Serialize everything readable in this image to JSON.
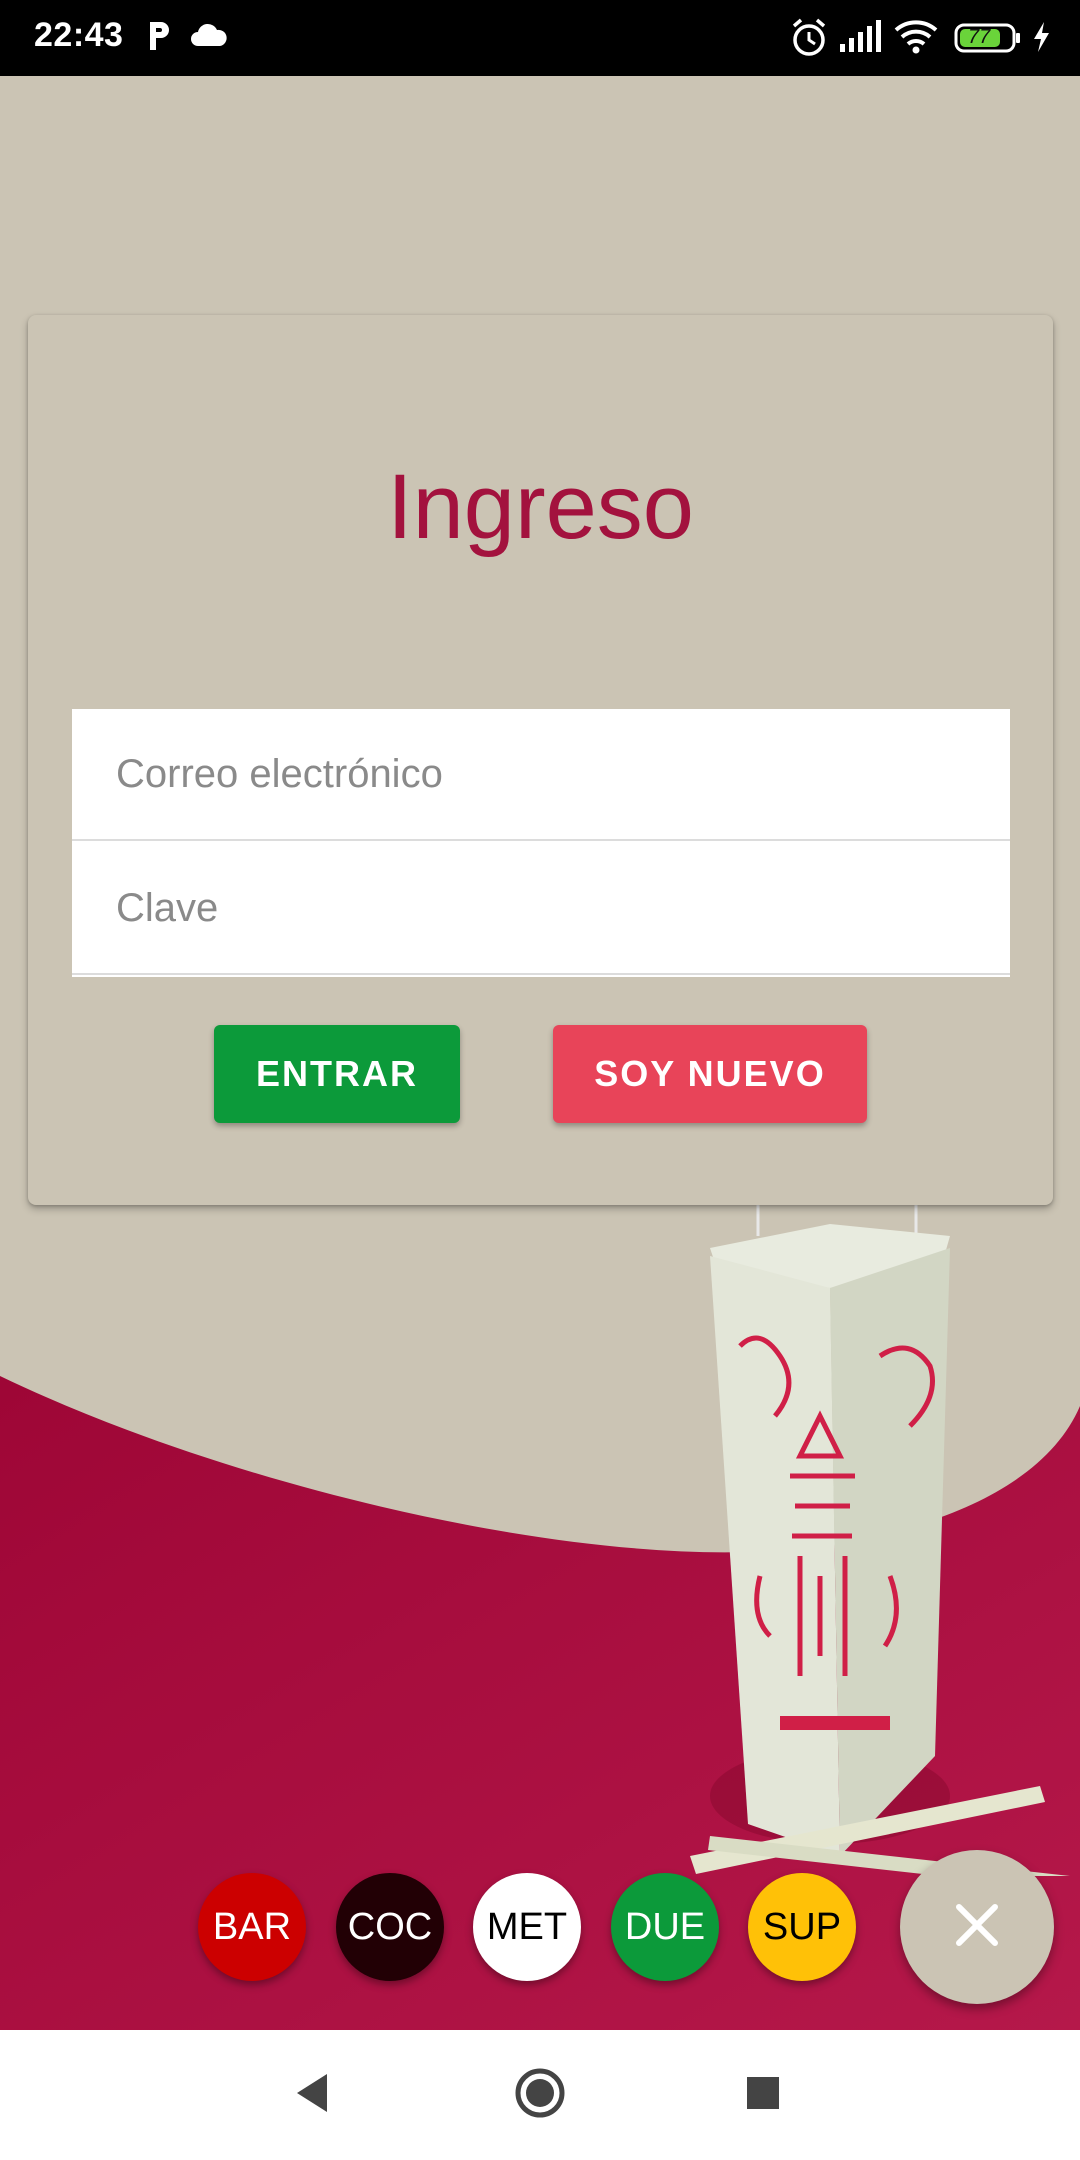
{
  "status_bar": {
    "time": "22:43",
    "battery": "77",
    "icons": [
      "parking-icon",
      "cloud-icon",
      "alarm-icon",
      "signal-icon",
      "wifi-icon",
      "battery-icon",
      "charging-icon"
    ]
  },
  "login": {
    "title": "Ingreso",
    "email_placeholder": "Correo electrónico",
    "password_placeholder": "Clave",
    "enter_label": "ENTRAR",
    "new_label": "SOY NUEVO"
  },
  "roles": [
    {
      "label": "BAR",
      "color": "#cc0000",
      "text_color": "#ffffff"
    },
    {
      "label": "COC",
      "color": "#220005",
      "text_color": "#ffffff"
    },
    {
      "label": "MET",
      "color": "#ffffff",
      "text_color": "#000000"
    },
    {
      "label": "DUE",
      "color": "#0c9a3a",
      "text_color": "#ffffff"
    },
    {
      "label": "SUP",
      "color": "#ffc107",
      "text_color": "#000000"
    }
  ],
  "fab": {
    "icon": "close-icon"
  },
  "nav_bar": {
    "icons": [
      "back-icon",
      "home-icon",
      "recents-icon"
    ]
  },
  "colors": {
    "background": "#cbc4b4",
    "accent_wine": "#a3123e",
    "enter_green": "#0c9a3a",
    "new_red": "#e84459"
  }
}
